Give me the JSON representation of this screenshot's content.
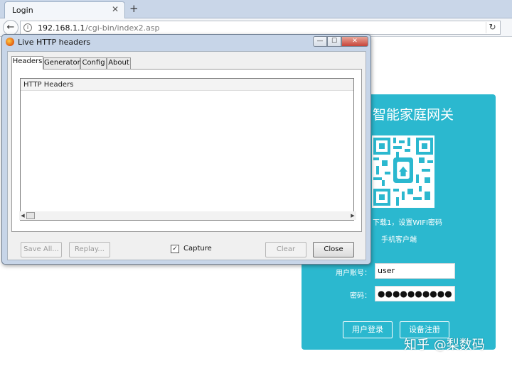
{
  "browser": {
    "tab_title": "Login",
    "tab_close": "✕",
    "new_tab": "+",
    "url_host": "192.168.1.1",
    "url_path": "/cgi-bin/index2.asp",
    "icons": [
      "back-icon",
      "info-icon",
      "reload-icon"
    ]
  },
  "router_page": {
    "title": "智能家庭网关",
    "qr_hint": "下载1，设置WIFI密码",
    "client_label": "手机客户端",
    "username_label": "用户账号：",
    "username_value": "user",
    "password_label": "密码：",
    "password_value": "●●●●●●●●●●",
    "login_button": "用户登录",
    "register_button": "设备注册",
    "accent_color": "#2bb8cf"
  },
  "watermark": "知乎 @梨数码",
  "dialog": {
    "title": "Live HTTP headers",
    "window_buttons": {
      "minimize": "—",
      "maximize": "☐",
      "close": "✕"
    },
    "tabs": [
      "Headers",
      "Generator",
      "Config",
      "About"
    ],
    "active_tab": "Headers",
    "headers_heading": "HTTP Headers",
    "buttons": {
      "save_all": "Save All...",
      "replay": "Replay...",
      "clear": "Clear",
      "close": "Close"
    },
    "capture_label": "Capture",
    "capture_checked": true,
    "capture_mark": "✓"
  }
}
